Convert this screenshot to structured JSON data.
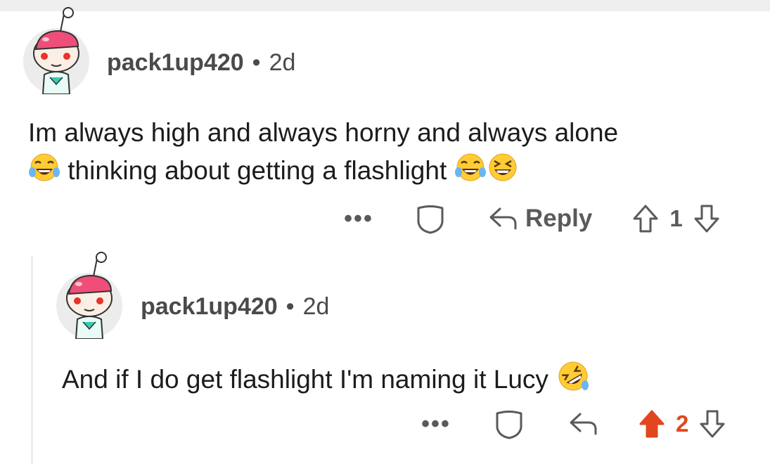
{
  "comments": [
    {
      "username": "pack1up420",
      "separator": "•",
      "age": "2d",
      "text_line1": "Im always high and always horny and always alone",
      "text_line2": "thinking about getting a flashlight",
      "actions": {
        "more": "•••",
        "reply_label": "Reply",
        "vote_count": "1"
      }
    },
    {
      "username": "pack1up420",
      "separator": "•",
      "age": "2d",
      "text": "And if I do get flashlight I'm naming it Lucy",
      "actions": {
        "more": "•••",
        "vote_count": "2"
      }
    }
  ],
  "colors": {
    "upvote_active": "#e2461f",
    "muted": "#5a5a5a"
  }
}
